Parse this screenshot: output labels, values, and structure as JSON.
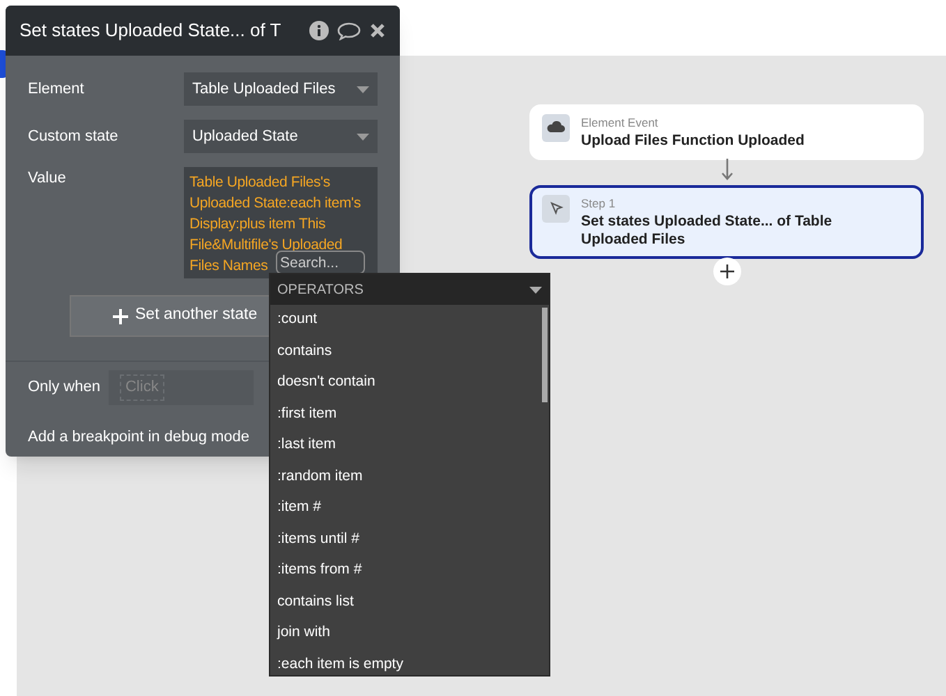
{
  "panel": {
    "title": "Set states Uploaded State... of T",
    "fields": [
      {
        "label": "Element",
        "value": "Table Uploaded Files"
      },
      {
        "label": "Custom state",
        "value": "Uploaded State"
      }
    ],
    "value_label": "Value",
    "value_text": "Table Uploaded Files's Uploaded State:each item's Display:plus item This File&Multifile's Uploaded Files Names",
    "search": {
      "placeholder": "Search..."
    },
    "add_button": "Set another state",
    "only_when": {
      "label": "Only when",
      "placeholder": "Click"
    },
    "breakpoint": "Add a breakpoint in debug mode"
  },
  "dropdown": {
    "header": "OPERATORS",
    "items": [
      ":count",
      "contains",
      "doesn't contain",
      ":first item",
      ":last item",
      ":random item",
      ":item #",
      ":items until #",
      ":items from #",
      "contains list",
      "join with",
      ":each item is empty"
    ]
  },
  "workflow": {
    "event": {
      "caption": "Element Event",
      "title": "Upload Files Function Uploaded"
    },
    "step": {
      "caption": "Step 1",
      "title": "Set states Uploaded State... of Table Uploaded Files",
      "selected": true
    }
  }
}
